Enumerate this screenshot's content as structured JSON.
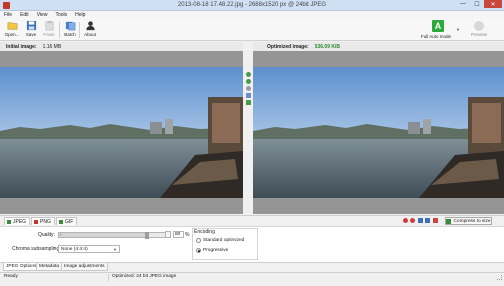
{
  "window": {
    "title": "2013-08-18 17.48.22.jpg - 2688x1520 px @ 24bit JPEG",
    "controls": [
      "—",
      "☐",
      "✕"
    ]
  },
  "menu": [
    "File",
    "Edit",
    "View",
    "Tools",
    "Help"
  ],
  "toolbar": {
    "open": "Open...",
    "save": "Save",
    "paste": "Paste",
    "batch": "Batch",
    "about": "About",
    "auto_mode_letter": "A",
    "auto_mode": "Full Auto mode",
    "preview": "Preview"
  },
  "initial": {
    "label": "Initial image:",
    "size": "1.16 MB"
  },
  "optimized": {
    "label": "Optimized image:",
    "size": "536.09 KiB"
  },
  "format_tabs": [
    "JPEG",
    "PNG",
    "GIF"
  ],
  "compress_label": "Compress to size",
  "options": {
    "quality_label": "Quality:",
    "quality_value": "80",
    "quality_level": 0.8,
    "quality_unit": "%",
    "chroma_label": "Chroma subsampling:",
    "chroma_value": "None (4:4:4)",
    "encoding_title": "Encoding",
    "encoding_options": [
      "Standard optimized",
      "Progressive"
    ],
    "encoding_selected": "Progressive"
  },
  "bottom_tabs": [
    "JPEG Options",
    "Metadata",
    "Image adjustments"
  ],
  "status": {
    "ready": "Ready",
    "info": "Optimized: 24 bit JPEG image"
  },
  "colors": {
    "accent_green": "#2eaa3d",
    "optimized_size_green": "#2d8a2d",
    "close_red": "#c9463d"
  }
}
